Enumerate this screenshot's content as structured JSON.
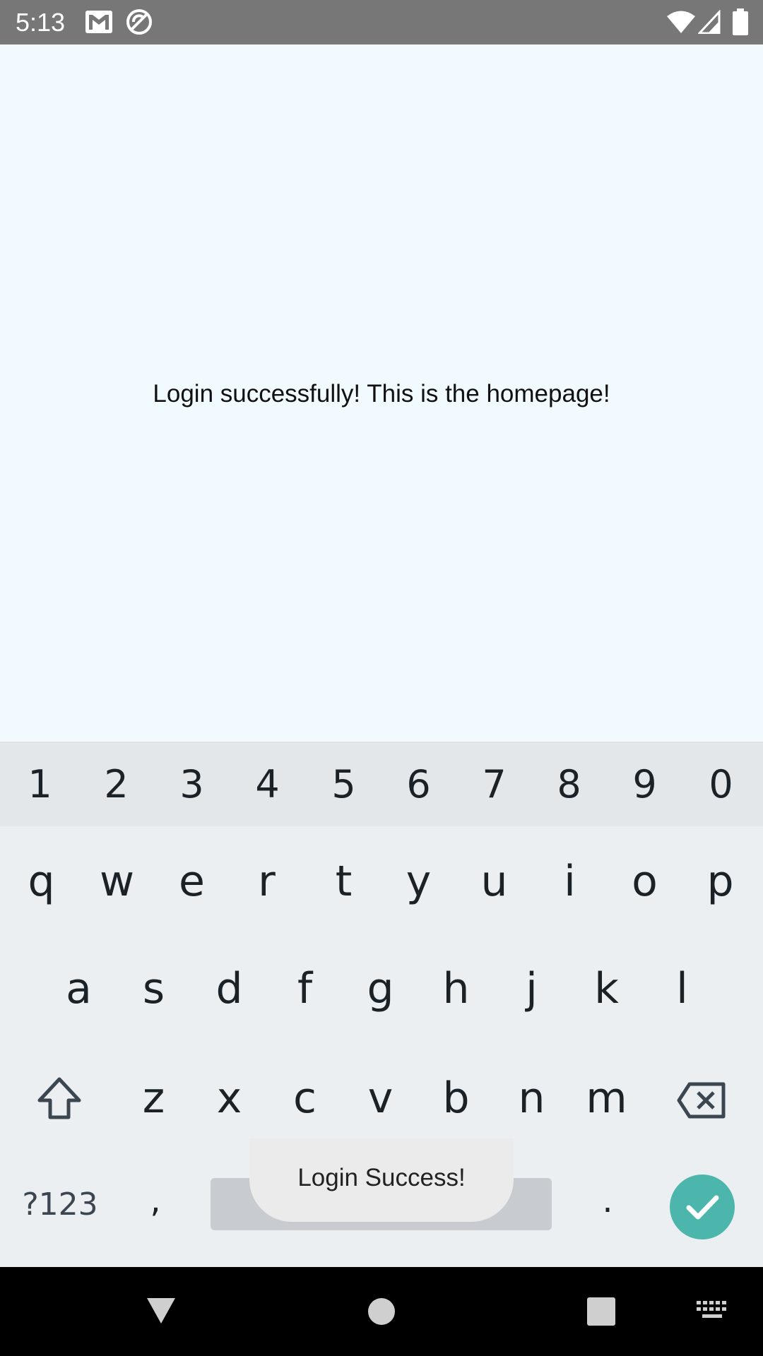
{
  "status_bar": {
    "time": "5:13",
    "icons": [
      "gmail-icon",
      "do-not-disturb-icon",
      "wifi-icon",
      "signal-icon",
      "battery-icon"
    ]
  },
  "app": {
    "message": "Login successfully! This is the homepage!",
    "background_color": "#f1faff"
  },
  "keyboard": {
    "number_row": [
      "1",
      "2",
      "3",
      "4",
      "5",
      "6",
      "7",
      "8",
      "9",
      "0"
    ],
    "row1": [
      "q",
      "w",
      "e",
      "r",
      "t",
      "y",
      "u",
      "i",
      "o",
      "p"
    ],
    "row2": [
      "a",
      "s",
      "d",
      "f",
      "g",
      "h",
      "j",
      "k",
      "l"
    ],
    "row3": [
      "z",
      "x",
      "c",
      "v",
      "b",
      "n",
      "m"
    ],
    "symbols_label": "?123",
    "comma_label": ",",
    "period_label": ".",
    "enter_color": "#4db6ac"
  },
  "toast": {
    "text": "Login Success!"
  },
  "nav_bar": {
    "icons": [
      "back-icon",
      "home-icon",
      "recents-icon",
      "keyboard-switch-icon"
    ]
  }
}
